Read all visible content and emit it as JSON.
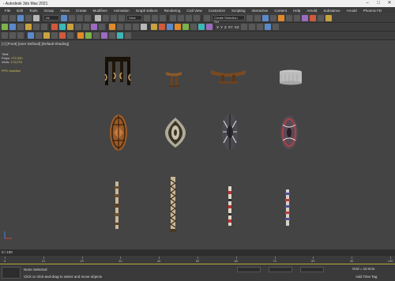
{
  "app": {
    "title": "- Autodesk 3ds Max 2021"
  },
  "menu": [
    "File",
    "Edit",
    "Tools",
    "Group",
    "Views",
    "Create",
    "Modifiers",
    "Animation",
    "Graph Editors",
    "Rendering",
    "Civil View",
    "Customize",
    "Scripting",
    "Interactive",
    "Content",
    "Help",
    "Arnold",
    "Substance",
    "Arnold",
    "Phoenix FD"
  ],
  "toolbar": {
    "selection_set_placeholder": "Create Selection Set",
    "view_dropdown": "All",
    "coord_system": "View",
    "axis_labels": [
      "X",
      "Y",
      "Z",
      "XY",
      "XZ"
    ]
  },
  "viewport": {
    "label": "[+] [Front] [User Defined] [Default Shading]",
    "stats": {
      "total_label": "Total",
      "polys_label": "Polys:",
      "polys_value": "172,320",
      "verts_label": "Verts:",
      "verts_value": "174,076"
    },
    "fps_label": "FPS:",
    "fps_value": "Inactive"
  },
  "timeline": {
    "frame_display": "0 / 100",
    "ticks": [
      0,
      10,
      20,
      30,
      40,
      50,
      60,
      70,
      80,
      90,
      100
    ]
  },
  "statusbar": {
    "selection": "None Selected",
    "prompt": "Click or click-and-drag to select and move objects",
    "grid": "Grid = 10.0cm",
    "add_time_tag": "Add Time Tag"
  },
  "colors": {
    "viewport_bg": "#444444",
    "stats_text": "#d8c850",
    "wood_dark": "#3a2410",
    "wood_mid": "#8b5a2b",
    "wood_light": "#c8a878"
  }
}
